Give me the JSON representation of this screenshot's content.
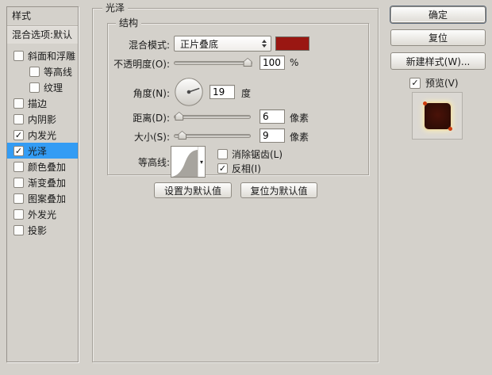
{
  "window": {
    "bg": "#d4d1cb",
    "selected_item_bg": "#339cf4"
  },
  "icons": {
    "check": "✓",
    "contour_arrow": "▾"
  },
  "sidebar": {
    "title": "样式",
    "blend_options_label": "混合选项:默认",
    "items": [
      {
        "label": "斜面和浮雕",
        "checked": false,
        "indent": false,
        "selected": false
      },
      {
        "label": "等高线",
        "checked": false,
        "indent": true,
        "selected": false
      },
      {
        "label": "纹理",
        "checked": false,
        "indent": true,
        "selected": false
      },
      {
        "label": "描边",
        "checked": false,
        "indent": false,
        "selected": false
      },
      {
        "label": "内阴影",
        "checked": false,
        "indent": false,
        "selected": false
      },
      {
        "label": "内发光",
        "checked": true,
        "indent": false,
        "selected": false
      },
      {
        "label": "光泽",
        "checked": true,
        "indent": false,
        "selected": true
      },
      {
        "label": "颜色叠加",
        "checked": false,
        "indent": false,
        "selected": false
      },
      {
        "label": "渐变叠加",
        "checked": false,
        "indent": false,
        "selected": false
      },
      {
        "label": "图案叠加",
        "checked": false,
        "indent": false,
        "selected": false
      },
      {
        "label": "外发光",
        "checked": false,
        "indent": false,
        "selected": false
      },
      {
        "label": "投影",
        "checked": false,
        "indent": false,
        "selected": false
      }
    ]
  },
  "panel": {
    "title": "光泽",
    "group_title": "结构",
    "blend_mode": {
      "label": "混合模式:",
      "value": "正片叠底",
      "swatch_color": "#9a1712"
    },
    "opacity": {
      "label": "不透明度(O):",
      "value": "100",
      "unit": "%",
      "thumb_left": "95%"
    },
    "angle": {
      "label": "角度(N):",
      "value": "19",
      "unit": "度"
    },
    "distance": {
      "label": "距离(D):",
      "value": "6",
      "unit": "像素",
      "thumb_left": "6%"
    },
    "size": {
      "label": "大小(S):",
      "value": "9",
      "unit": "像素",
      "thumb_left": "10%"
    },
    "contour": {
      "label": "等高线:",
      "anti_alias_label": "消除锯齿(L)",
      "anti_alias_checked": false,
      "invert_label": "反相(I)",
      "invert_checked": true
    },
    "set_default_label": "设置为默认值",
    "reset_default_label": "复位为默认值"
  },
  "actions": {
    "ok_label": "确定",
    "reset_label": "复位",
    "new_style_label": "新建样式(W)...",
    "preview_label": "预览(V)",
    "preview_checked": true
  }
}
